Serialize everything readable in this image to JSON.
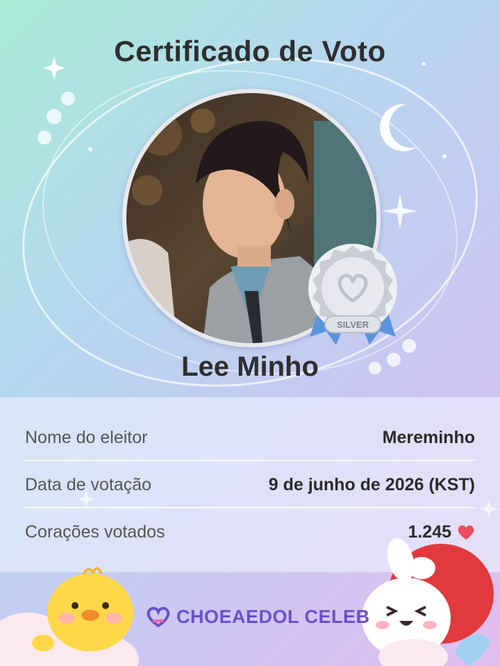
{
  "certificate": {
    "title": "Certificado de Voto",
    "celebrity_name": "Lee Minho",
    "badge_label": "SILVER",
    "rows": [
      {
        "label": "Nome do eleitor",
        "value": "Mereminho"
      },
      {
        "label": "Data de votação",
        "value": "9 de junho de 2026 (KST)"
      },
      {
        "label": "Corações votados",
        "value": "1.245"
      }
    ]
  },
  "footer": {
    "brand": "CHOEAEDOL CELEB"
  },
  "colors": {
    "brand": "#6a4fc6",
    "heart": "#ef4b5c",
    "badge_silver": "#c9cdd4",
    "ribbon": "#5b93dc"
  }
}
